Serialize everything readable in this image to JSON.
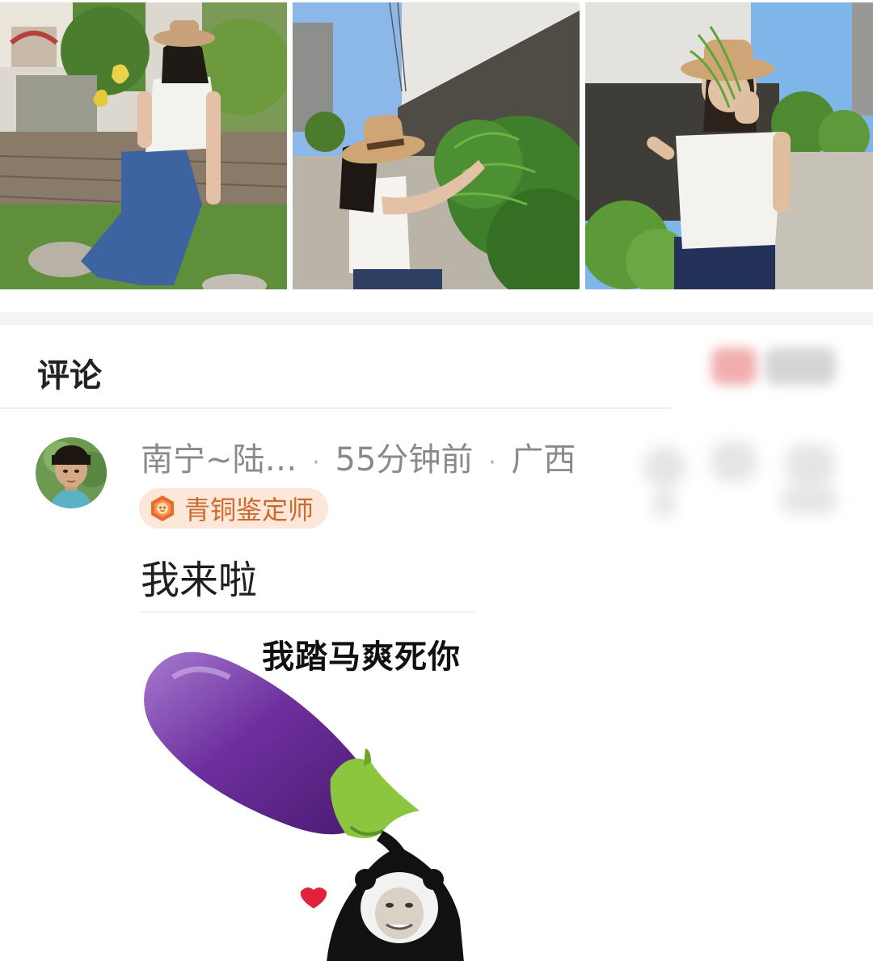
{
  "photos": [
    {
      "icon": "photo-garden-seated"
    },
    {
      "icon": "photo-touching-fern"
    },
    {
      "icon": "photo-fern-over-face"
    }
  ],
  "comments_section": {
    "title": "评论"
  },
  "comment": {
    "username": "南宁~陆…",
    "time": "55分钟前",
    "location": "广西",
    "separator": "·",
    "badge": {
      "label": "青铜鉴定师",
      "icon": "bronze-appraiser-icon"
    },
    "text": "我来啦",
    "sticker": {
      "caption": "我踏马爽死你",
      "icon": "eggplant-panda-sticker"
    }
  },
  "colors": {
    "badge_bg": "#fde7d8",
    "badge_text": "#c96a2e",
    "meta_text": "#8a8a8a",
    "eggplant": "#7b3aa8"
  }
}
